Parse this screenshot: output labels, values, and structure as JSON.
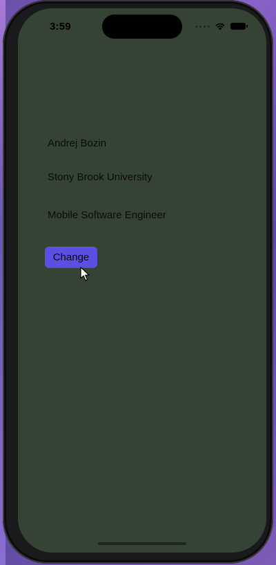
{
  "status_bar": {
    "time": "3:59",
    "icons": [
      "signal-dots-icon",
      "wifi-icon",
      "battery-icon"
    ]
  },
  "content": {
    "name": "Andrej Bozin",
    "university": "Stony Brook University",
    "role": "Mobile Software Engineer"
  },
  "actions": {
    "change_label": "Change"
  },
  "colors": {
    "screen_background": "#354334",
    "button_background": "#5b4ee2",
    "text": "#0a0a0a"
  }
}
